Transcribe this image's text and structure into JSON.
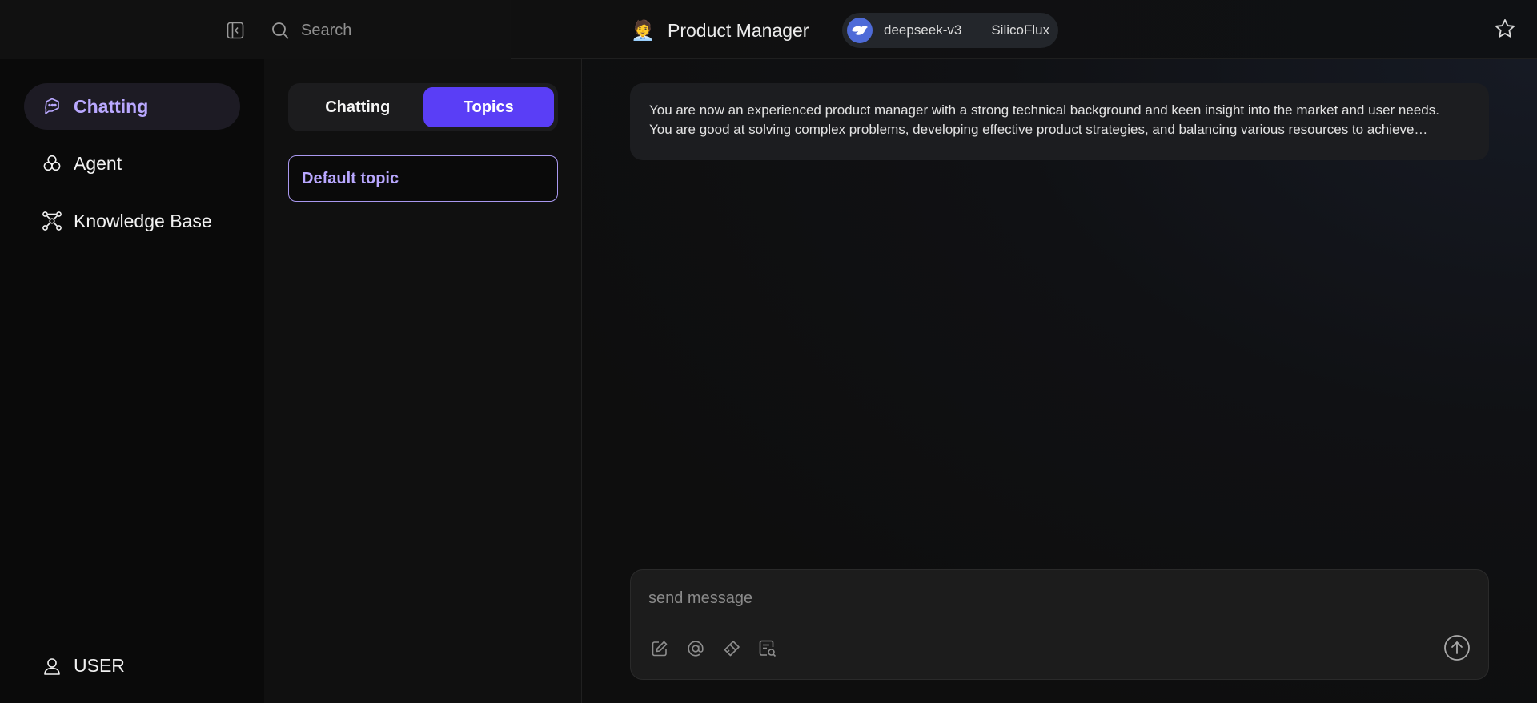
{
  "header": {
    "search": {
      "placeholder": "Search"
    },
    "agent": {
      "emoji": "🧑‍💼",
      "name": "Product Manager"
    },
    "model": {
      "name": "deepseek-v3",
      "provider": "SilicoFlux"
    }
  },
  "sidebar": {
    "items": [
      {
        "label": "Chatting",
        "icon": "chat-bubble-icon",
        "active": true
      },
      {
        "label": "Agent",
        "icon": "agent-icon",
        "active": false
      },
      {
        "label": "Knowledge Base",
        "icon": "knowledge-graph-icon",
        "active": false
      }
    ],
    "user": {
      "label": "USER",
      "icon": "user-icon"
    }
  },
  "topic_panel": {
    "tabs": [
      {
        "label": "Chatting",
        "active": false
      },
      {
        "label": "Topics",
        "active": true
      }
    ],
    "topics": [
      {
        "label": "Default topic",
        "selected": true
      }
    ]
  },
  "chat": {
    "system_prompt_lines": [
      "You are now an experienced product manager with a strong technical background and keen insight into the market and user needs.",
      "You are good at solving complex problems, developing effective product strategies, and balancing various resources to achieve…"
    ],
    "composer": {
      "placeholder": "send message",
      "tools": [
        "edit-icon",
        "at-mention-icon",
        "clear-icon",
        "search-doc-icon"
      ],
      "send_icon": "send-arrow-up-icon"
    }
  },
  "colors": {
    "accent": "#5a3ef6",
    "accent_text": "#b9a8ff",
    "background": "#0c0c0c"
  }
}
